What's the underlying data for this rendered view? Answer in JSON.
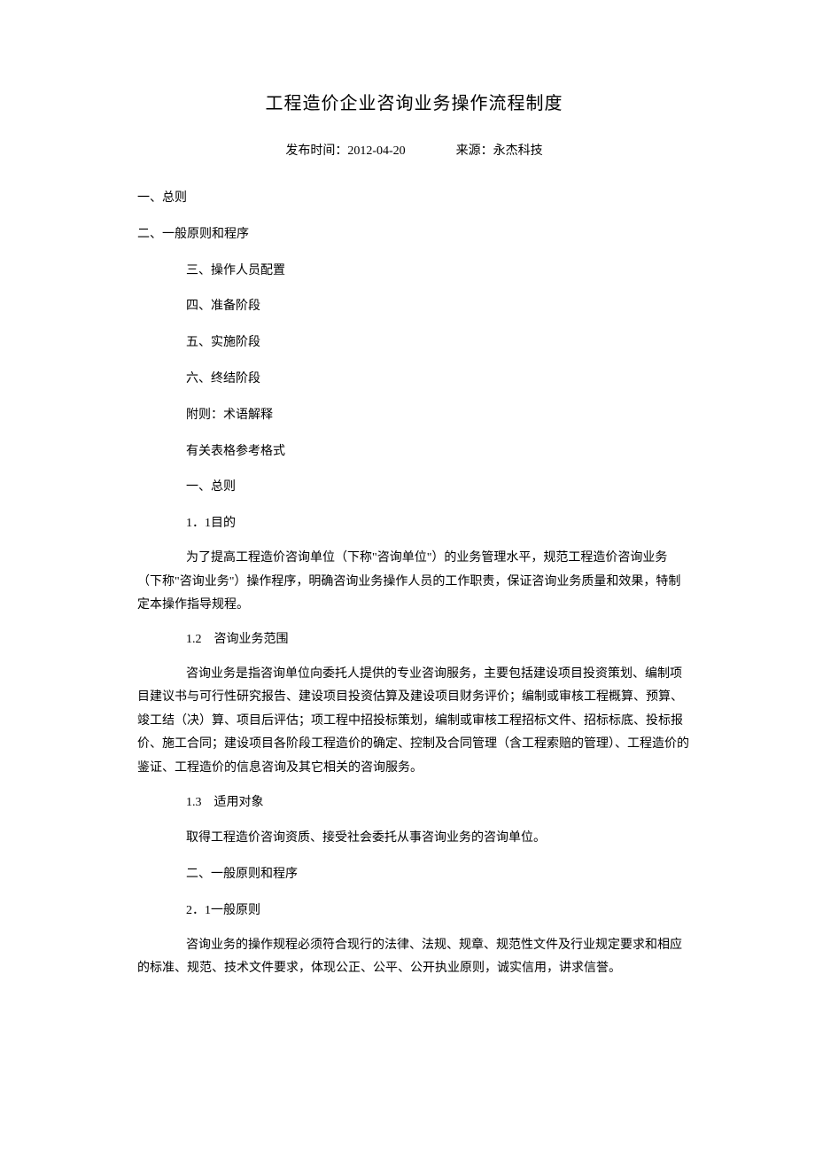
{
  "title": "工程造价企业咨询业务操作流程制度",
  "meta": {
    "publishLabel": "发布时间：",
    "publishDate": "2012-04-20",
    "sourceLabel": "来源：",
    "sourceValue": "永杰科技"
  },
  "lines": {
    "toc1": "一、总则",
    "toc2": "二、一般原则和程序",
    "toc3": "三、操作人员配置",
    "toc4": "四、准备阶段",
    "toc5": "五、实施阶段",
    "toc6": "六、终结阶段",
    "toc7": "附则：术语解释",
    "toc8": "有关表格参考格式",
    "h1": "一、总则",
    "s11": "1．1目的",
    "p11": "为了提高工程造价咨询单位（下称\"咨询单位\"）的业务管理水平，规范工程造价咨询业务（下称\"咨询业务\"）操作程序，明确咨询业务操作人员的工作职责，保证咨询业务质量和效果，特制定本操作指导规程。",
    "s12": "1.2　咨询业务范围",
    "p12": "咨询业务是指咨询单位向委托人提供的专业咨询服务，主要包括建设项目投资策划、编制项目建议书与可行性研究报告、建设项目投资估算及建设项目财务评价；编制或审核工程概算、预算、竣工结（决）算、项目后评估；项工程中招投标策划，编制或审核工程招标文件、招标标底、投标报价、施工合同；建设项目各阶段工程造价的确定、控制及合同管理（含工程索赔的管理）、工程造价的鉴证、工程造价的信息咨询及其它相关的咨询服务。",
    "s13": "1.3　适用对象",
    "p13": "取得工程造价咨询资质、接受社会委托从事咨询业务的咨询单位。",
    "h2": "二、一般原则和程序",
    "s21": "2．1一般原则",
    "p21": "咨询业务的操作规程必须符合现行的法律、法规、规章、规范性文件及行业规定要求和相应的标准、规范、技术文件要求，体现公正、公平、公开执业原则，诚实信用，讲求信誉。"
  }
}
